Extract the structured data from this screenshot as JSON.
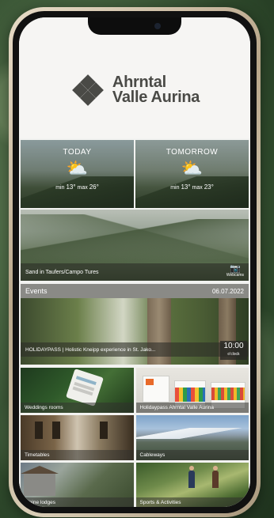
{
  "brand": {
    "line1": "Ahrntal",
    "line2": "Valle Aurina"
  },
  "weather": {
    "today": {
      "label": "TODAY",
      "icon": "partly-cloudy-icon",
      "min_label": "min",
      "min": "13°",
      "max_label": "max",
      "max": "26°"
    },
    "tomorrow": {
      "label": "TOMORROW",
      "icon": "partly-cloudy-icon",
      "min_label": "min",
      "min": "13°",
      "max_label": "max",
      "max": "23°"
    }
  },
  "webcam": {
    "location": "Sand in Taufers/Campo Tures",
    "badge": "Webcams"
  },
  "events": {
    "title": "Events",
    "date": "06.07.2022",
    "caption": "HOLIDAYPASS | Holistic Kneipp experience in St. Jako...",
    "time": "10:00",
    "time_label": "o'clock"
  },
  "tiles": [
    {
      "label": "Weddings rooms"
    },
    {
      "label": "Holidaypass Ahrntal Valle Aurina"
    },
    {
      "label": "Timetables"
    },
    {
      "label": "Cableways"
    },
    {
      "label": "Alpine lodges"
    },
    {
      "label": "Sports & Activities"
    }
  ],
  "colors": {
    "logo": "#4a4a46",
    "caption_bg": "rgba(50,50,45,0.55)"
  }
}
